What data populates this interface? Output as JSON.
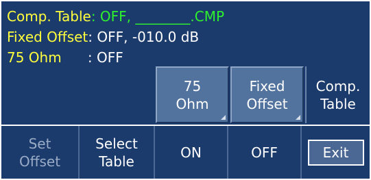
{
  "status": {
    "comp_table_label": "Comp. Table",
    "comp_table_sep": ":",
    "comp_table_state": " OFF,",
    "comp_table_file": " ________.CMP",
    "fixed_offset_label": "Fixed Offset",
    "fixed_offset_sep": ":",
    "fixed_offset_state": " OFF,",
    "fixed_offset_value": " -010.0 dB",
    "ohm_label": "75 Ohm",
    "ohm_sep": "      :",
    "ohm_state": " OFF"
  },
  "softkeys_top": [
    {
      "line1": "75",
      "line2": "Ohm"
    },
    {
      "line1": "Fixed",
      "line2": "Offset"
    },
    {
      "line1": "Comp.",
      "line2": "Table"
    }
  ],
  "softkeys_bottom": [
    {
      "line1": "Set",
      "line2": "Offset"
    },
    {
      "line1": "Select",
      "line2": "Table"
    },
    {
      "line1": "ON",
      "line2": ""
    },
    {
      "line1": "OFF",
      "line2": ""
    },
    {
      "line1": "Exit",
      "line2": ""
    }
  ],
  "colors": {
    "background": "#1c3b6d",
    "label": "#ffff3c",
    "green_value": "#2ef12e",
    "key_raised": "#52739e"
  }
}
